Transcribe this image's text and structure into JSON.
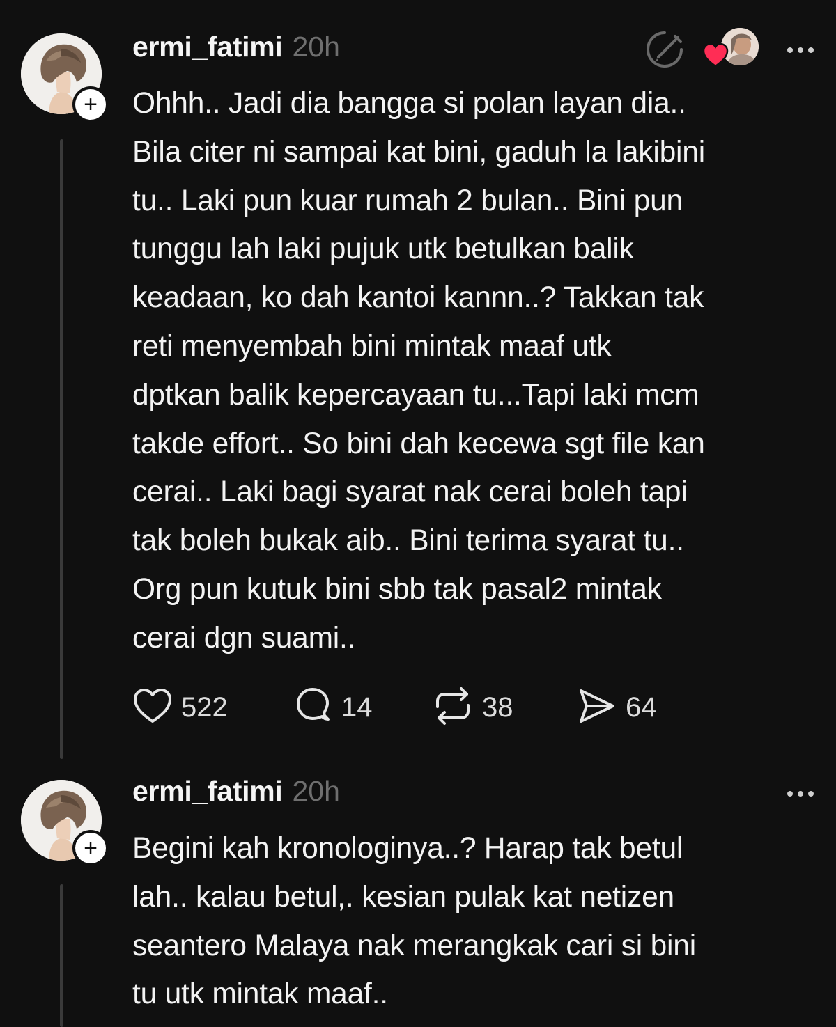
{
  "posts": [
    {
      "username": "ermi_fatimi",
      "time": "20h",
      "lines": [
        "Ohhh.. Jadi dia bangga si polan layan dia..",
        "Bila citer ni sampai kat bini, gaduh la lakibini",
        "tu.. Laki pun kuar rumah 2 bulan.. Bini pun",
        "tunggu lah laki pujuk utk betulkan balik",
        "keadaan, ko dah kantoi kannn..? Takkan tak",
        "reti menyembah bini mintak maaf utk",
        "dptkan balik kepercayaan tu...Tapi laki mcm",
        "takde effort.. So bini dah kecewa sgt file kan",
        "cerai.. Laki bagi syarat nak cerai boleh tapi",
        "tak boleh bukak aib.. Bini terima syarat tu..",
        "Org pun kutuk bini sbb tak pasal2 mintak",
        "cerai dgn suami.."
      ],
      "stats": {
        "likes": "522",
        "replies": "14",
        "reposts": "38",
        "shares": "64"
      },
      "icons": {
        "follow": "+",
        "edited": "edited-check-icon",
        "liked_by": "liker-avatar",
        "heart_badge": "heart-badge-icon",
        "more": "more-icon"
      }
    },
    {
      "username": "ermi_fatimi",
      "time": "20h",
      "lines": [
        "Begini kah kronologinya..? Harap tak betul",
        "lah.. kalau betul,. kesian pulak kat netizen",
        "seantero Malaya nak merangkak cari si bini",
        "tu utk mintak maaf.."
      ],
      "icons": {
        "follow": "+",
        "more": "more-icon"
      }
    }
  ],
  "colors": {
    "background": "#101010",
    "text": "#f3f3f3",
    "muted": "#6f6f6f",
    "heart": "#ff2d55"
  }
}
